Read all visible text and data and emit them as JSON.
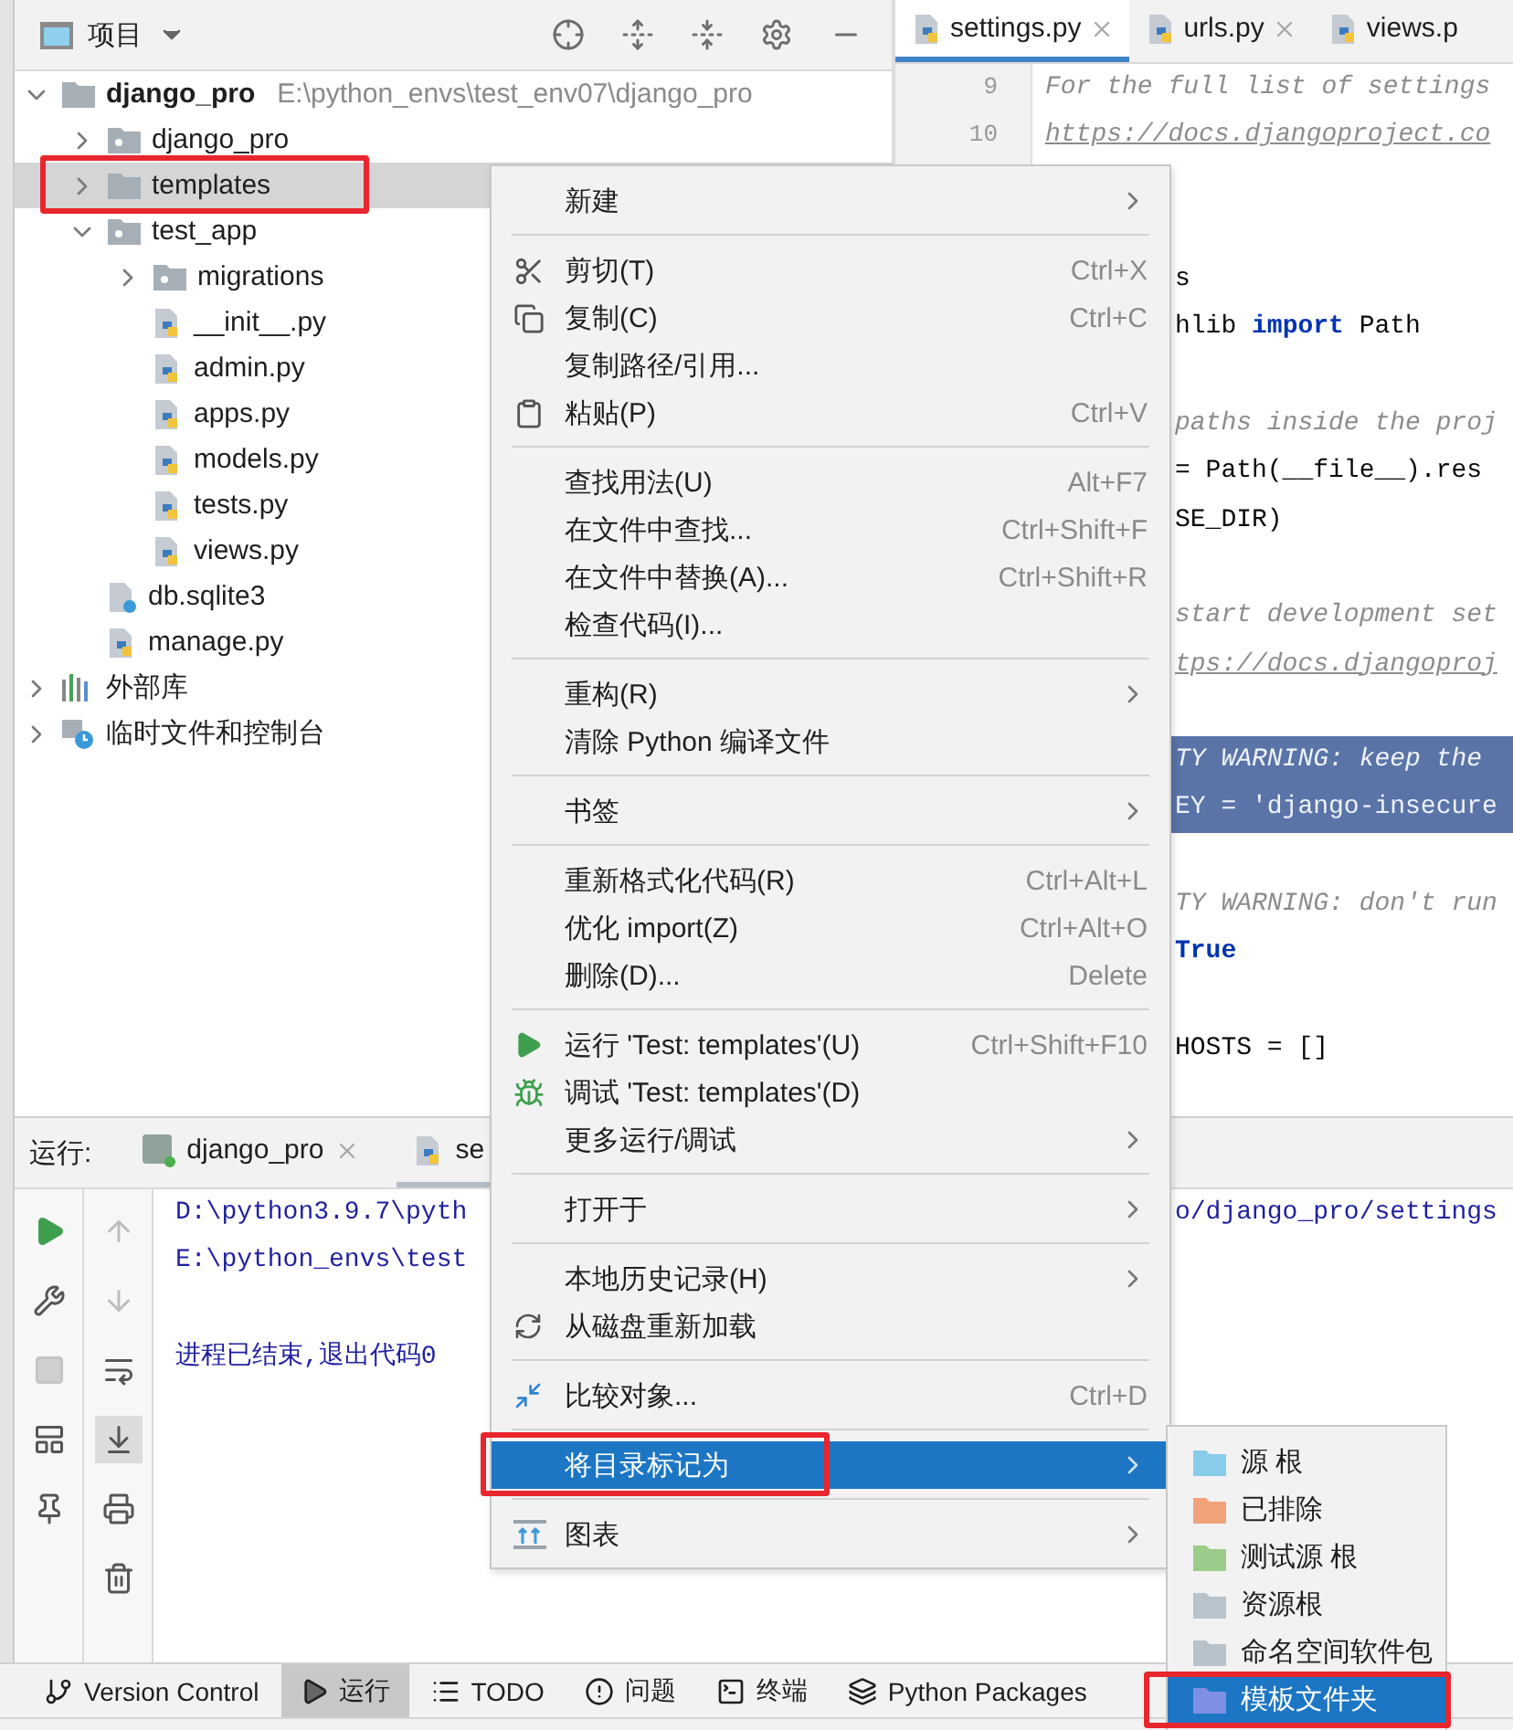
{
  "project_panel": {
    "title": "项目",
    "tree": [
      {
        "label": "django_pro",
        "path": "E:\\python_envs\\test_env07\\django_pro",
        "kind": "folder",
        "expanded": true,
        "selected": false,
        "children": [
          {
            "label": "django_pro",
            "kind": "package",
            "expanded": false,
            "selected": false
          },
          {
            "label": "templates",
            "kind": "folder",
            "expanded": false,
            "selected": true,
            "highlighted": true
          },
          {
            "label": "test_app",
            "kind": "package",
            "expanded": true,
            "selected": false,
            "children": [
              {
                "label": "migrations",
                "kind": "package",
                "expanded": false,
                "selected": false
              },
              {
                "label": "__init__.py",
                "kind": "python",
                "selected": false
              },
              {
                "label": "admin.py",
                "kind": "python",
                "selected": false
              },
              {
                "label": "apps.py",
                "kind": "python",
                "selected": false
              },
              {
                "label": "models.py",
                "kind": "python",
                "selected": false
              },
              {
                "label": "tests.py",
                "kind": "python",
                "selected": false
              },
              {
                "label": "views.py",
                "kind": "python",
                "selected": false
              }
            ]
          },
          {
            "label": "db.sqlite3",
            "kind": "unknown",
            "selected": false
          },
          {
            "label": "manage.py",
            "kind": "python",
            "selected": false
          }
        ]
      },
      {
        "label": "外部库",
        "kind": "library",
        "expanded": false,
        "selected": false
      },
      {
        "label": "临时文件和控制台",
        "kind": "scratch",
        "expanded": false,
        "selected": false
      }
    ]
  },
  "editor": {
    "tabs": [
      {
        "label": "settings.py",
        "selected": true,
        "closable": true
      },
      {
        "label": "urls.py",
        "selected": false,
        "closable": true
      },
      {
        "label": "views.p",
        "selected": false
      }
    ],
    "lines": [
      {
        "number": "9",
        "kind": "comment",
        "text": "For the full list of settings"
      },
      {
        "number": "10",
        "kind": "link",
        "text": "https://docs.djangoproject.co"
      },
      {
        "kind": "blank"
      },
      {
        "kind": "blank"
      },
      {
        "kind": "code",
        "text": "s"
      },
      {
        "kind": "code",
        "text": "hlib **import** Path"
      },
      {
        "kind": "blank"
      },
      {
        "kind": "comment",
        "text": "paths inside the proj"
      },
      {
        "kind": "code",
        "text": "= Path(__file__).res"
      },
      {
        "kind": "code",
        "text": "SE_DIR)"
      },
      {
        "kind": "blank"
      },
      {
        "kind": "comment",
        "text": "start development set"
      },
      {
        "kind": "link",
        "text": "tps://docs.djangoproj"
      },
      {
        "kind": "blank"
      },
      {
        "kind": "comment",
        "text": "TY WARNING: keep the",
        "selected": true
      },
      {
        "kind": "code",
        "text": "EY = 'django-insecure",
        "selected": true
      },
      {
        "kind": "blank"
      },
      {
        "kind": "comment",
        "text": "TY WARNING: don't run"
      },
      {
        "kind": "code",
        "text": "**True**"
      },
      {
        "kind": "blank"
      },
      {
        "kind": "code",
        "text": "HOSTS = []"
      }
    ]
  },
  "run_panel": {
    "label": "运行:",
    "tabs": [
      {
        "label": "django_pro",
        "kind": "django",
        "selected": false,
        "closable": true
      },
      {
        "label": "se",
        "kind": "python",
        "selected": true
      }
    ],
    "console": [
      {
        "kind": "output",
        "text": "D:\\python3.9.7\\pyth",
        "tail": "o/django_pro/settings"
      },
      {
        "kind": "output",
        "text": "E:\\python_envs\\test"
      },
      {
        "kind": "blank"
      },
      {
        "kind": "output",
        "text": "进程已结束,退出代码0"
      }
    ]
  },
  "tool_windows": [
    {
      "label": "Version Control",
      "kind": "branch",
      "selected": false
    },
    {
      "label": "运行",
      "kind": "run",
      "selected": true
    },
    {
      "label": "TODO",
      "kind": "list",
      "selected": false
    },
    {
      "label": "问题",
      "kind": "problems",
      "selected": false
    },
    {
      "label": "终端",
      "kind": "terminal",
      "selected": false
    },
    {
      "label": "Python Packages",
      "kind": "packages",
      "selected": false
    }
  ],
  "context_menu": {
    "groups": [
      {
        "items": [
          {
            "label": "新建",
            "submenu": true,
            "selected": false
          }
        ]
      },
      {
        "items": [
          {
            "label": "剪切(T)",
            "kind": "cut",
            "shortcut": "Ctrl+X",
            "selected": false
          },
          {
            "label": "复制(C)",
            "kind": "copy",
            "shortcut": "Ctrl+C",
            "selected": false
          },
          {
            "label": "复制路径/引用...",
            "selected": false
          },
          {
            "label": "粘贴(P)",
            "kind": "paste",
            "shortcut": "Ctrl+V",
            "selected": false
          }
        ]
      },
      {
        "items": [
          {
            "label": "查找用法(U)",
            "shortcut": "Alt+F7",
            "selected": false
          },
          {
            "label": "在文件中查找...",
            "shortcut": "Ctrl+Shift+F",
            "selected": false
          },
          {
            "label": "在文件中替换(A)...",
            "shortcut": "Ctrl+Shift+R",
            "selected": false
          },
          {
            "label": "检查代码(I)...",
            "selected": false
          }
        ]
      },
      {
        "items": [
          {
            "label": "重构(R)",
            "submenu": true,
            "selected": false
          },
          {
            "label": "清除 Python 编译文件",
            "selected": false
          }
        ]
      },
      {
        "items": [
          {
            "label": "书签",
            "submenu": true,
            "selected": false
          }
        ]
      },
      {
        "items": [
          {
            "label": "重新格式化代码(R)",
            "shortcut": "Ctrl+Alt+L",
            "selected": false
          },
          {
            "label": "优化 import(Z)",
            "shortcut": "Ctrl+Alt+O",
            "selected": false
          },
          {
            "label": "删除(D)...",
            "shortcut": "Delete",
            "selected": false
          }
        ]
      },
      {
        "items": [
          {
            "label": "运行 'Test: templates'(U)",
            "kind": "run",
            "shortcut": "Ctrl+Shift+F10",
            "selected": false
          },
          {
            "label": "调试 'Test: templates'(D)",
            "kind": "debug",
            "selected": false
          },
          {
            "label": "更多运行/调试",
            "submenu": true,
            "selected": false
          }
        ]
      },
      {
        "items": [
          {
            "label": "打开于",
            "submenu": true,
            "selected": false
          }
        ]
      },
      {
        "items": [
          {
            "label": "本地历史记录(H)",
            "submenu": true,
            "selected": false
          },
          {
            "label": "从磁盘重新加载",
            "kind": "reload",
            "selected": false
          }
        ]
      },
      {
        "items": [
          {
            "label": "比较对象...",
            "kind": "compare",
            "shortcut": "Ctrl+D",
            "selected": false
          }
        ]
      },
      {
        "items": [
          {
            "label": "将目录标记为",
            "submenu": true,
            "selected": true,
            "highlighted": true
          }
        ]
      },
      {
        "items": [
          {
            "label": "图表",
            "kind": "diagram",
            "submenu": true,
            "selected": false
          }
        ]
      }
    ]
  },
  "submenu": {
    "items": [
      {
        "label": "源 根",
        "color": "#87cdea",
        "selected": false
      },
      {
        "label": "已排除",
        "color": "#f2a27a",
        "selected": false
      },
      {
        "label": "测试源 根",
        "color": "#9ccc8a",
        "selected": false
      },
      {
        "label": "资源根",
        "color": "#b9c3cb",
        "selected": false
      },
      {
        "label": "命名空间软件包",
        "color": "#b8c2ca",
        "selected": false
      },
      {
        "label": "模板文件夹",
        "color": "#7f8fe3",
        "selected": true,
        "highlighted": true
      }
    ]
  }
}
